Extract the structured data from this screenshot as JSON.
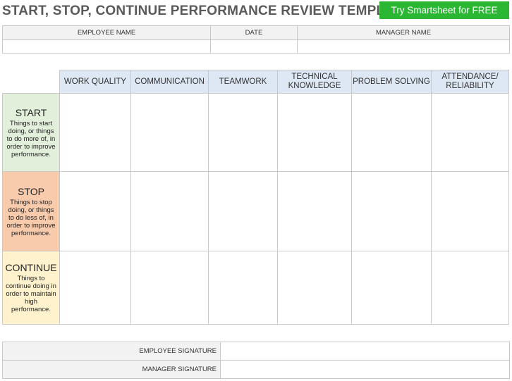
{
  "title": "START, STOP, CONTINUE PERFORMANCE REVIEW TEMPLATE",
  "cta": {
    "label": "Try Smartsheet for FREE"
  },
  "header": {
    "employee_name_label": "EMPLOYEE NAME",
    "date_label": "DATE",
    "manager_name_label": "MANAGER NAME",
    "employee_name_value": "",
    "date_value": "",
    "manager_name_value": ""
  },
  "columns": [
    "WORK QUALITY",
    "COMMUNICATION",
    "TEAMWORK",
    "TECHNICAL KNOWLEDGE",
    "PROBLEM SOLVING",
    "ATTENDANCE/ RELIABILITY"
  ],
  "rows": [
    {
      "title": "START",
      "description": "Things to start doing, or things to do more of, in order to improve performance.",
      "color": "#e2efda"
    },
    {
      "title": "STOP",
      "description": "Things to stop doing, or things to do less of, in order to improve performance.",
      "color": "#f8cbad"
    },
    {
      "title": "CONTINUE",
      "description": "Things to continue doing in order to maintain high performance.",
      "color": "#fff2cc"
    }
  ],
  "signatures": {
    "employee_label": "EMPLOYEE SIGNATURE",
    "manager_label": "MANAGER SIGNATURE"
  },
  "colors": {
    "title": "#5a5a5a",
    "cta_background": "#2bb734",
    "column_header_background": "#dde8f4",
    "label_background": "#f2f2f2"
  }
}
